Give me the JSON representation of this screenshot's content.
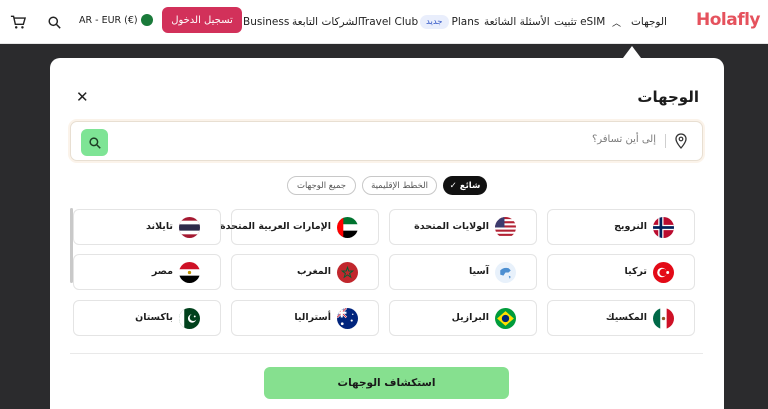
{
  "nav": {
    "logo": "Holafly",
    "destinations": "الوجهات",
    "install_esim": "تثبيت eSIM",
    "faq": "الأسئلة الشائعة",
    "plans": "Plans",
    "new_badge": "جديد",
    "travel_club": "Travel Club",
    "affiliates": "الشركات التابعة",
    "business": "Business",
    "login": "تسجيل الدخول",
    "currency": "AR - EUR (€)"
  },
  "modal": {
    "title": "الوجهات",
    "search_placeholder": "إلى أين تسافر؟",
    "tabs": {
      "popular": "شائع",
      "regional": "الخطط الإقليمية",
      "all": "جميع الوجهات"
    },
    "destinations": [
      {
        "label": "النرويج",
        "icon": "norway-flag-icon"
      },
      {
        "label": "الولايات المتحدة",
        "icon": "usa-flag-icon"
      },
      {
        "label": "الإمارات العربية المتحدة",
        "icon": "uae-flag-icon"
      },
      {
        "label": "تايلاند",
        "icon": "thailand-flag-icon"
      },
      {
        "label": "تركيا",
        "icon": "turkey-flag-icon"
      },
      {
        "label": "آسيا",
        "icon": "asia-globe-icon"
      },
      {
        "label": "المغرب",
        "icon": "morocco-flag-icon"
      },
      {
        "label": "مصر",
        "icon": "egypt-flag-icon"
      },
      {
        "label": "المكسيك",
        "icon": "mexico-flag-icon"
      },
      {
        "label": "البرازيل",
        "icon": "brazil-flag-icon"
      },
      {
        "label": "أستراليا",
        "icon": "australia-flag-icon"
      },
      {
        "label": "باكستان",
        "icon": "pakistan-flag-icon"
      }
    ],
    "explore_button": "استكشاف الوجهات"
  },
  "colors": {
    "brand": "#e5525d",
    "login_button": "#d2315a",
    "search_button": "#7ee495",
    "explore_button": "#86e08f"
  }
}
